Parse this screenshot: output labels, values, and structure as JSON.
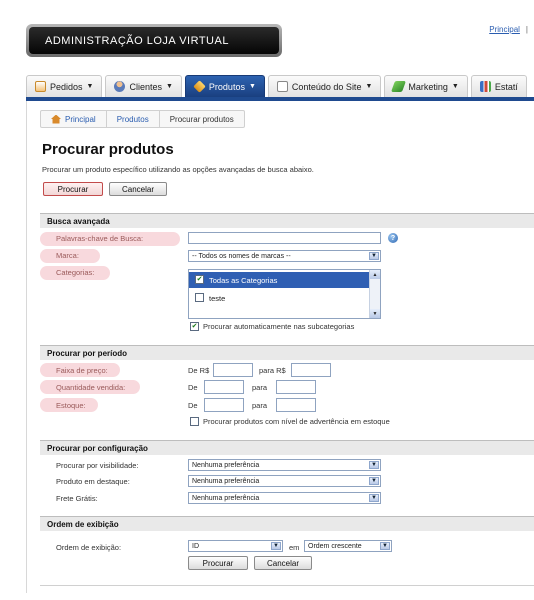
{
  "header": {
    "logo_text": "ADMINISTRAÇÃO  LOJA VIRTUAL",
    "top_link": "Principal",
    "top_sep": "|"
  },
  "tabs": [
    {
      "label": "Pedidos",
      "icon": "orders-icon"
    },
    {
      "label": "Clientes",
      "icon": "customers-icon"
    },
    {
      "label": "Produtos",
      "icon": "products-icon",
      "active": true
    },
    {
      "label": "Conteúdo do Site",
      "icon": "content-icon"
    },
    {
      "label": "Marketing",
      "icon": "marketing-icon"
    },
    {
      "label": "Estatí",
      "icon": "stats-icon"
    }
  ],
  "breadcrumb": [
    "Principal",
    "Produtos",
    "Procurar produtos"
  ],
  "page": {
    "title": "Procurar produtos",
    "description": "Procurar um produto específico utilizando as opções avançadas de busca abaixo.",
    "search_button": "Procurar",
    "cancel_button": "Cancelar"
  },
  "busca": {
    "heading": "Busca avançada",
    "keywords_label": "Palavras-chave de Busca:",
    "keywords_value": "",
    "brand_label": "Marca:",
    "brand_value": "-- Todos os nomes de marcas --",
    "categories_label": "Categorias:",
    "categories": [
      {
        "label": "Todas as Categorias",
        "checked": true
      },
      {
        "label": "teste",
        "checked": false
      }
    ],
    "subcategories_label": "Procurar automaticamente nas subcategorias",
    "subcategories_checked": true
  },
  "periodo": {
    "heading": "Procurar por período",
    "price_label": "Faixa de preço:",
    "price_from": "De R$",
    "price_to": "para R$",
    "qty_label": "Quantidade vendida:",
    "qty_from": "De",
    "qty_to": "para",
    "stock_label": "Estoque:",
    "stock_from": "De",
    "stock_to": "para",
    "stock_warning_label": "Procurar produtos com nível de advertência em estoque",
    "stock_warning_checked": false
  },
  "config": {
    "heading": "Procurar por configuração",
    "visibility_label": "Procurar por visibilidade:",
    "visibility_value": "Nenhuma preferência",
    "featured_label": "Produto em destaque:",
    "featured_value": "Nenhuma preferência",
    "shipping_label": "Frete Grátis:",
    "shipping_value": "Nenhuma preferência"
  },
  "ordem": {
    "heading": "Ordem de exibição",
    "label": "Ordem de exibição:",
    "field_value": "ID",
    "between": "em",
    "direction_value": "Ordem crescente",
    "search_button": "Procurar",
    "cancel_button": "Cancelar"
  }
}
